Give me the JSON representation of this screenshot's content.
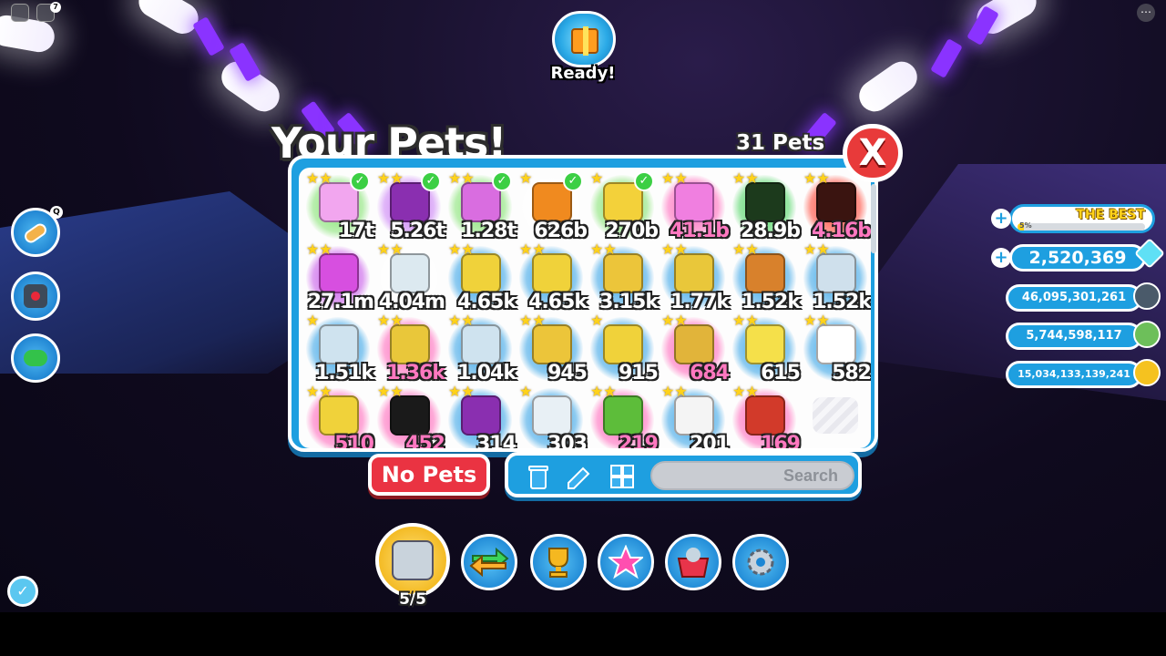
{
  "topbar": {
    "roblox_icon": "roblox-menu-icon",
    "chat_icon": "chat-icon",
    "chat_badge": "7",
    "more_icon": "more-options-icon"
  },
  "gift": {
    "label": "Ready!",
    "icon": "gift-icon"
  },
  "side_buttons": [
    {
      "name": "item-bandage-icon",
      "key": "Q"
    },
    {
      "name": "joystick-icon",
      "key": ""
    },
    {
      "name": "eco-recycle-icon",
      "key": ""
    }
  ],
  "inventory": {
    "title": "Your Pets!",
    "count": "31 Pets",
    "close_label": "X",
    "pets": [
      {
        "value": "17t",
        "pink": false,
        "equipped": true,
        "color": "#f2a6ef",
        "glow": "#7ee26a",
        "stars": "★★"
      },
      {
        "value": "5.26t",
        "pink": false,
        "equipped": true,
        "color": "#8a2fb0",
        "glow": "#c879f5",
        "stars": "★★"
      },
      {
        "value": "1.28t",
        "pink": false,
        "equipped": true,
        "color": "#d96de0",
        "glow": "#7ee26a",
        "stars": "★★"
      },
      {
        "value": "626b",
        "pink": false,
        "equipped": true,
        "color": "#f08a1f",
        "glow": "#ffffff",
        "stars": "★"
      },
      {
        "value": "270b",
        "pink": false,
        "equipped": true,
        "color": "#f3d13a",
        "glow": "#7ee26a",
        "stars": "★"
      },
      {
        "value": "41.1b",
        "pink": true,
        "equipped": false,
        "color": "#f07fe0",
        "glow": "#ff61b8",
        "stars": "★★"
      },
      {
        "value": "28.9b",
        "pink": false,
        "equipped": false,
        "color": "#1c3a1c",
        "glow": "#45d35b",
        "stars": "★★"
      },
      {
        "value": "4.16b",
        "pink": true,
        "equipped": false,
        "color": "#3a1410",
        "glow": "#ff3b2b",
        "stars": "★★"
      },
      {
        "value": "27.1m",
        "pink": false,
        "equipped": false,
        "color": "#d74fe0",
        "glow": "#c44fe8",
        "stars": "★★"
      },
      {
        "value": "4.04m",
        "pink": false,
        "equipped": false,
        "color": "#dce9f0",
        "glow": "#ffffff",
        "stars": "★★"
      },
      {
        "value": "4.65k",
        "pink": false,
        "equipped": false,
        "color": "#f0d23a",
        "glow": "#2c9fe6",
        "stars": "★★"
      },
      {
        "value": "4.65k",
        "pink": false,
        "equipped": false,
        "color": "#f0d23a",
        "glow": "#2c9fe6",
        "stars": "★★"
      },
      {
        "value": "3.15k",
        "pink": false,
        "equipped": false,
        "color": "#ecc53a",
        "glow": "#2c9fe6",
        "stars": "★★"
      },
      {
        "value": "1.77k",
        "pink": false,
        "equipped": false,
        "color": "#e9c73a",
        "glow": "#2c9fe6",
        "stars": "★★"
      },
      {
        "value": "1.52k",
        "pink": false,
        "equipped": false,
        "color": "#d8812c",
        "glow": "#2c9fe6",
        "stars": "★★"
      },
      {
        "value": "1.52k",
        "pink": false,
        "equipped": false,
        "color": "#cfe0ec",
        "glow": "#2c9fe6",
        "stars": "★★"
      },
      {
        "value": "1.51k",
        "pink": false,
        "equipped": false,
        "color": "#cfe3ef",
        "glow": "#2c9fe6",
        "stars": "★"
      },
      {
        "value": "1.36k",
        "pink": true,
        "equipped": false,
        "color": "#e9c73a",
        "glow": "#ff61b8",
        "stars": "★★"
      },
      {
        "value": "1.04k",
        "pink": false,
        "equipped": false,
        "color": "#cfe3ef",
        "glow": "#2c9fe6",
        "stars": "★★"
      },
      {
        "value": "945",
        "pink": false,
        "equipped": false,
        "color": "#ecc53a",
        "glow": "#2c9fe6",
        "stars": "★★"
      },
      {
        "value": "915",
        "pink": false,
        "equipped": false,
        "color": "#f0d23a",
        "glow": "#2c9fe6",
        "stars": "★"
      },
      {
        "value": "684",
        "pink": true,
        "equipped": false,
        "color": "#e1b43a",
        "glow": "#ff61b8",
        "stars": "★★"
      },
      {
        "value": "615",
        "pink": false,
        "equipped": false,
        "color": "#f5e04a",
        "glow": "#2c9fe6",
        "stars": "★★"
      },
      {
        "value": "582",
        "pink": false,
        "equipped": false,
        "color": "#ffffff",
        "glow": "#2c9fe6",
        "stars": "★★"
      },
      {
        "value": "510",
        "pink": true,
        "equipped": false,
        "color": "#f0d23a",
        "glow": "#ff61b8",
        "stars": "★★"
      },
      {
        "value": "452",
        "pink": true,
        "equipped": false,
        "color": "#1a1a1a",
        "glow": "#ff61b8",
        "stars": "★★"
      },
      {
        "value": "314",
        "pink": false,
        "equipped": false,
        "color": "#8a2fb0",
        "glow": "#2c9fe6",
        "stars": "★★"
      },
      {
        "value": "303",
        "pink": false,
        "equipped": false,
        "color": "#e8f0f5",
        "glow": "#2c9fe6",
        "stars": "★"
      },
      {
        "value": "219",
        "pink": true,
        "equipped": false,
        "color": "#5dbd3a",
        "glow": "#ff61b8",
        "stars": "★★"
      },
      {
        "value": "201",
        "pink": false,
        "equipped": false,
        "color": "#f4f4f4",
        "glow": "#2c9fe6",
        "stars": "★★"
      },
      {
        "value": "169",
        "pink": true,
        "equipped": false,
        "color": "#d23a2a",
        "glow": "#ff61b8",
        "stars": "★★"
      }
    ]
  },
  "controls": {
    "no_pets_label": "No Pets",
    "trash_icon": "trash-icon",
    "rename_icon": "pencil-icon",
    "grid_icon": "grid-icon",
    "search_placeholder": "Search"
  },
  "hotbar": {
    "pets_label": "5/5",
    "items": [
      "pets-icon",
      "trade-arrows-icon",
      "trophy-icon",
      "star-icon",
      "shop-basket-icon",
      "settings-gear-icon"
    ]
  },
  "currency": {
    "rank_label": "THE BEST",
    "rank_percent": "5%",
    "rank_progress": 0.05,
    "diamonds": "2,520,369",
    "coin_a": "46,095,301,261",
    "coin_b": "5,744,598,117",
    "coin_c": "15,034,133,139,241"
  }
}
